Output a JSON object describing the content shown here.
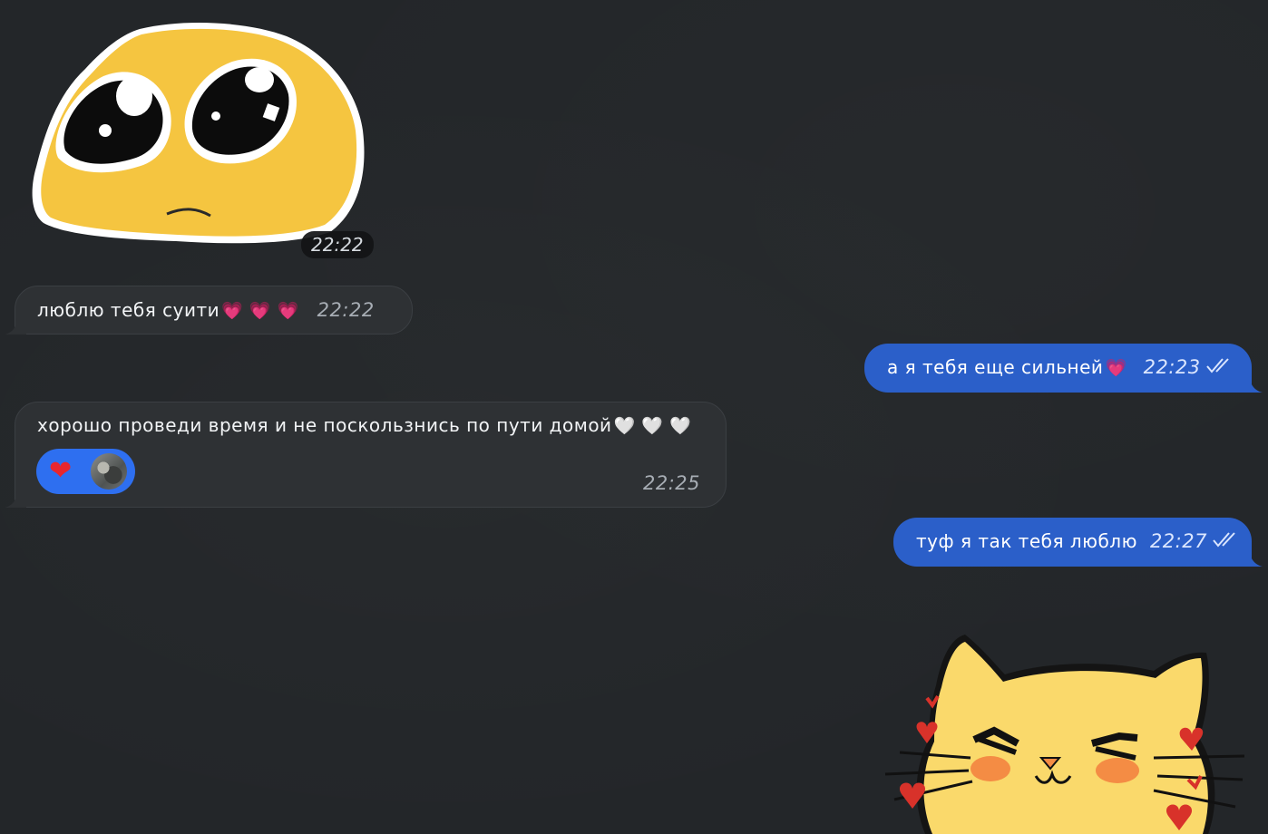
{
  "messages": [
    {
      "type": "sticker",
      "direction": "incoming",
      "sticker": "teary-eyed-yellow-face-sticker",
      "time": "22:22"
    },
    {
      "type": "text",
      "direction": "incoming",
      "text": "люблю тебя суити",
      "emoji": "💗 💗 💗",
      "time": "22:22"
    },
    {
      "type": "text",
      "direction": "outgoing",
      "text": "а я тебя еще сильней",
      "emoji": "💗",
      "time": "22:23",
      "status": "read"
    },
    {
      "type": "text",
      "direction": "incoming",
      "text": "хорошо проведи время и не поскользнись по пути домой",
      "emoji": "🤍 🤍 🤍",
      "time": "22:25",
      "reaction": {
        "emoji": "❤",
        "avatar": "user-avatar"
      }
    },
    {
      "type": "text",
      "direction": "outgoing",
      "text": "туф я так тебя люблю",
      "time": "22:27",
      "status": "read"
    },
    {
      "type": "sticker",
      "direction": "outgoing",
      "sticker": "blushing-yellow-cat-with-hearts-sticker"
    }
  ],
  "colors": {
    "background": "#232629",
    "incoming_bubble": "#2e3134",
    "outgoing_bubble": "#2b5fc9",
    "reaction_pill": "#2e6ff0"
  }
}
